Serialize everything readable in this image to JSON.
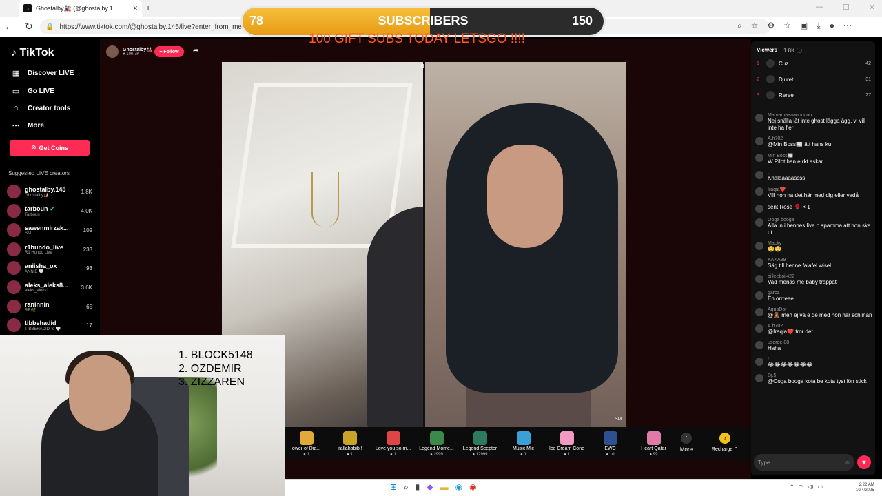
{
  "browser": {
    "tab_title": "Ghostalby🎎 (@ghostalby.1",
    "url": "https://www.tiktok.com/@ghostalby.145/live?enter_from_me"
  },
  "sidebar": {
    "logo": "TikTok",
    "nav": [
      {
        "label": "Discover LIVE",
        "icon": "discover-icon"
      },
      {
        "label": "Go LIVE",
        "icon": "camera-icon"
      },
      {
        "label": "Creator tools",
        "icon": "creator-tools-icon"
      },
      {
        "label": "More",
        "icon": "ellipsis-icon"
      }
    ],
    "get_coins": "Get Coins",
    "suggested_title": "Suggested LIVE creators",
    "creators": [
      {
        "name": "ghostalby.145",
        "sub": "Ghostalby🎎",
        "count": "1.8K"
      },
      {
        "name": "tarboun",
        "sub": "Tarboun",
        "count": "4.0K"
      },
      {
        "name": "sawenmirzak...",
        "sub": "SM",
        "count": "109"
      },
      {
        "name": "r1hundo_live",
        "sub": "R1 Hundo Live",
        "count": "233"
      },
      {
        "name": "aniisha_ox",
        "sub": "ANNIE 🤍",
        "count": "93"
      },
      {
        "name": "aleks_aleks8...",
        "sub": "aleks_aleks1",
        "count": "3.6K"
      },
      {
        "name": "raninnin",
        "sub": "RR🌿",
        "count": "65"
      },
      {
        "name": "tibbehadid",
        "sub": "TIBBEHADIDPs 🤍",
        "count": "17"
      }
    ]
  },
  "host": {
    "name": "Ghostalby🎎",
    "likes": "100.7K",
    "follow_label": "+ Follow"
  },
  "overlay": {
    "subs_current": "78",
    "subs_label": "SUBSCRIBERS",
    "subs_goal": "150",
    "subs_progress": 0.52,
    "message": "100 GIFT SUBS TODAY LETSGO !!!!",
    "top3": [
      "1. BLOCK5148",
      "2. OZDEMIR",
      "3. ZIZZAREN"
    ]
  },
  "video": {
    "right_tag": "SM"
  },
  "gifts": [
    {
      "name": "ower of Dia...",
      "price": "1",
      "color": "#e0a93a"
    },
    {
      "name": "Yallahabibi!",
      "price": "1",
      "color": "#c9a227"
    },
    {
      "name": "Love you so m...",
      "price": "1",
      "color": "#e04545"
    },
    {
      "name": "Legend Mome...",
      "price": "2999",
      "color": "#3b8a4a"
    },
    {
      "name": "Legend Scepter",
      "price": "12999",
      "color": "#2d7a5e"
    },
    {
      "name": "Music Mic",
      "price": "1",
      "color": "#3aa0d8"
    },
    {
      "name": "Ice Cream Cone",
      "price": "1",
      "color": "#f39ac0"
    },
    {
      "name": "EWC",
      "price": "10",
      "color": "#2f4f8f"
    },
    {
      "name": "Heart Qatar",
      "price": "99",
      "color": "#e07aa6"
    }
  ],
  "gift_more": "More",
  "recharge": "Recharge",
  "chat": {
    "viewers_label": "Viewers",
    "viewers_count": "1.8K",
    "ranking": [
      {
        "rank": "1",
        "name": "Cuz",
        "score": "42"
      },
      {
        "rank": "2",
        "name": "Djuret",
        "score": "31"
      },
      {
        "rank": "3",
        "name": "Reree",
        "score": "27"
      }
    ],
    "messages": [
      {
        "user": "Mamamaaaaoooooo",
        "text": "Nej snälla låt inte ghost lägga ägg, vi vill inte ha fler"
      },
      {
        "user": "A.h702",
        "text": "@Min Boss📰 ätt hans ku"
      },
      {
        "user": "Min Boss📰",
        "text": "W Pilot han e rkt askar"
      },
      {
        "user": ".",
        "text": "Khalaaaaassss"
      },
      {
        "user": "Iraqia❤️",
        "text": "Vill hon ha det här med dig eller vadå"
      },
      {
        "user": "",
        "text": "sent Rose 🌹 × 1"
      },
      {
        "user": "Ooga booga",
        "text": "Alla in i hennes live o spamma att hon ska ut"
      },
      {
        "user": "Macky",
        "text": "🥺🥺"
      },
      {
        "user": "KAKA99",
        "text": "Säg till henne falafel wisel"
      },
      {
        "user": "billeeboii422",
        "text": "Vad menas me baby trappat"
      },
      {
        "user": "garca",
        "text": "En orrreee"
      },
      {
        "user": "AquaDor",
        "text": "@🧸 men ej va e de med hon här schlinan"
      },
      {
        "user": "A.h702",
        "text": "@Iraqia❤️ tror det"
      },
      {
        "user": "userde.88",
        "text": "Haha"
      },
      {
        "user": "!",
        "text": "😂😂😂😂😂😂😂"
      },
      {
        "user": "Dj.5",
        "text": "@Ooga booga kota be kota tyst lön stick"
      }
    ],
    "input_placeholder": "Type..."
  },
  "clock": {
    "time": "2:22 AM",
    "date": "10/4/2025"
  }
}
